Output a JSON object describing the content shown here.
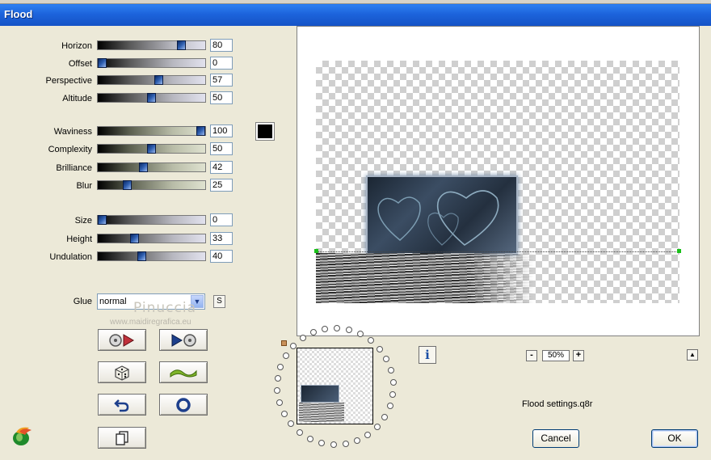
{
  "window": {
    "title": "Flood"
  },
  "params": [
    {
      "id": "horizon",
      "label": "Horizon",
      "value": 80,
      "track": "grey"
    },
    {
      "id": "offset",
      "label": "Offset",
      "value": 0,
      "track": "grey"
    },
    {
      "id": "perspective",
      "label": "Perspective",
      "value": 57,
      "track": "grey"
    },
    {
      "id": "altitude",
      "label": "Altitude",
      "value": 50,
      "track": "grey"
    },
    {
      "id": "waviness",
      "label": "Waviness",
      "value": 100,
      "track": "green"
    },
    {
      "id": "complexity",
      "label": "Complexity",
      "value": 50,
      "track": "green"
    },
    {
      "id": "brilliance",
      "label": "Brilliance",
      "value": 42,
      "track": "green"
    },
    {
      "id": "blur",
      "label": "Blur",
      "value": 25,
      "track": "green"
    },
    {
      "id": "size",
      "label": "Size",
      "value": 0,
      "track": "grey"
    },
    {
      "id": "height",
      "label": "Height",
      "value": 33,
      "track": "grey"
    },
    {
      "id": "undulation",
      "label": "Undulation",
      "value": 40,
      "track": "grey"
    }
  ],
  "color_swatch": "#000000",
  "glue": {
    "label": "Glue",
    "value": "normal",
    "s_button": "S"
  },
  "watermark": {
    "name": "Pinuccia",
    "url": "www.maidiregrafica.eu"
  },
  "tool_buttons": [
    {
      "id": "prev-preset",
      "icon": "disc-arrow-right-icon"
    },
    {
      "id": "next-preset",
      "icon": "arrow-right-disc-icon"
    },
    {
      "id": "randomize",
      "icon": "dice-icon"
    },
    {
      "id": "wave",
      "icon": "wave-icon"
    },
    {
      "id": "undo",
      "icon": "undo-arrow-icon"
    },
    {
      "id": "reset",
      "icon": "ring-icon"
    },
    {
      "id": "copy",
      "icon": "copy-pages-icon"
    }
  ],
  "zoom": {
    "value": "50%",
    "minus": "-",
    "plus": "+"
  },
  "info_button": "i",
  "settings_file": "Flood settings.q8r",
  "buttons": {
    "cancel": "Cancel",
    "ok": "OK"
  },
  "scroll_up": "▲"
}
